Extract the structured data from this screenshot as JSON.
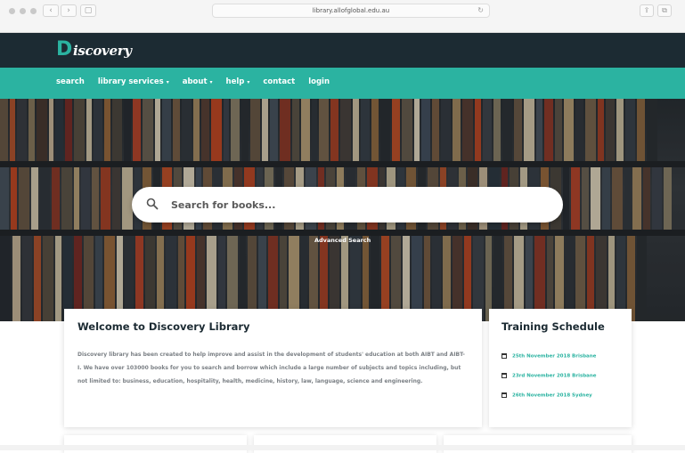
{
  "browser": {
    "url": "library.allofglobal.edu.au",
    "back_icon": "chevron-left-icon",
    "forward_icon": "chevron-right-icon",
    "reload_icon": "reload-icon",
    "share_icon": "share-icon",
    "tabs_icon": "tabs-icon"
  },
  "header": {
    "logo_initial": "D",
    "logo_rest": "iscovery"
  },
  "nav": {
    "items": [
      {
        "label": "search"
      },
      {
        "label": "library services"
      },
      {
        "label": "about"
      },
      {
        "label": "help"
      },
      {
        "label": "contact"
      },
      {
        "label": "login"
      }
    ],
    "caret": "▾"
  },
  "hero": {
    "search_placeholder": "Search for books...",
    "advanced_search": "Advanced Search"
  },
  "welcome": {
    "title": "Welcome to Discovery Library",
    "body": "Discovery library has been created to help improve and assist in the development of students' education at both AIBT and AIBT-I. We have over 103000 books for you to search and borrow which include a large number of subjects and topics including, but not limited to: business, education, hospitality, health, medicine, history, law, language, science and engineering."
  },
  "training": {
    "title": "Training Schedule",
    "items": [
      {
        "text": "25th November 2018 Brisbane"
      },
      {
        "text": "23rd November 2018 Brisbane"
      },
      {
        "text": "26th November 2018 Sydney"
      }
    ]
  },
  "colors": {
    "accent": "#2bb3a1",
    "header": "#1c2b33"
  }
}
